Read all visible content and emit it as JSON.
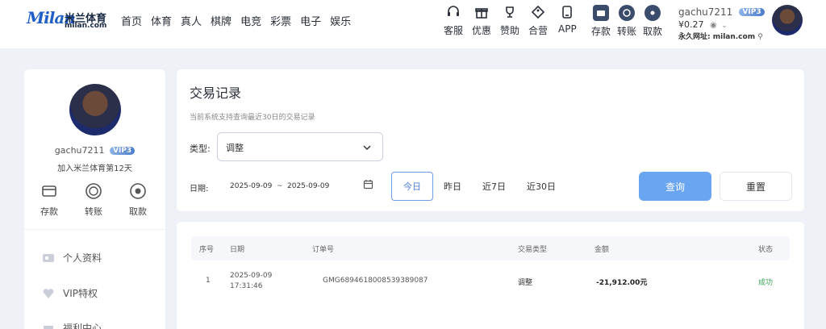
{
  "logo": {
    "mark": "Milan",
    "cn": "米兰体育",
    "sub": "milan.com"
  },
  "nav": [
    "首页",
    "体育",
    "真人",
    "棋牌",
    "电竞",
    "彩票",
    "电子",
    "娱乐"
  ],
  "tools": [
    {
      "label": "客服",
      "icon": "headset-icon"
    },
    {
      "label": "优惠",
      "icon": "gift-icon"
    },
    {
      "label": "赞助",
      "icon": "trophy-icon"
    },
    {
      "label": "合营",
      "icon": "diamond-tag-icon"
    },
    {
      "label": "APP",
      "icon": "phone-icon"
    }
  ],
  "actions": [
    {
      "label": "存款",
      "icon": "wallet-icon"
    },
    {
      "label": "转账",
      "icon": "transfer-icon"
    },
    {
      "label": "取款",
      "icon": "withdraw-icon"
    }
  ],
  "user": {
    "name": "gachu7211",
    "vip": "VIP3",
    "balance": "¥0.27",
    "address": "永久网址: milan.com"
  },
  "sidebar": {
    "name": "gachu7211",
    "vip": "VIP3",
    "joined": "加入米兰体育第12天",
    "actions": [
      {
        "label": "存款",
        "icon": "wallet-icon"
      },
      {
        "label": "转账",
        "icon": "transfer-icon"
      },
      {
        "label": "取款",
        "icon": "withdraw-icon"
      }
    ],
    "menu": [
      {
        "label": "个人资料",
        "icon": "profile-card-icon"
      },
      {
        "label": "VIP特权",
        "icon": "vip-heart-icon"
      },
      {
        "label": "福利中心",
        "icon": "gift-box-icon"
      }
    ]
  },
  "filter": {
    "title": "交易记录",
    "note": "当前系统支持查询最近30日的交易记录",
    "type_label": "类型:",
    "type_value": "调整",
    "date_label": "日期:",
    "date_from": "2025-09-09",
    "date_sep": "~",
    "date_to": "2025-09-09",
    "ranges": [
      "今日",
      "昨日",
      "近7日",
      "近30日"
    ],
    "active_range": "今日",
    "query": "查询",
    "reset": "重置"
  },
  "table": {
    "headers": [
      "序号",
      "日期",
      "订单号",
      "交易类型",
      "金额",
      "状态"
    ],
    "rows": [
      {
        "index": "1",
        "date": "2025-09-09",
        "time": "17:31:46",
        "order": "GMG6894618008539389087",
        "type": "调整",
        "amount": "-21,912.00元",
        "status": "成功"
      }
    ]
  },
  "colors": {
    "accent": "#6aa5f2",
    "success": "#3ba55c",
    "nav_text": "#2a2f3a",
    "brand": "#1f5fc7"
  }
}
